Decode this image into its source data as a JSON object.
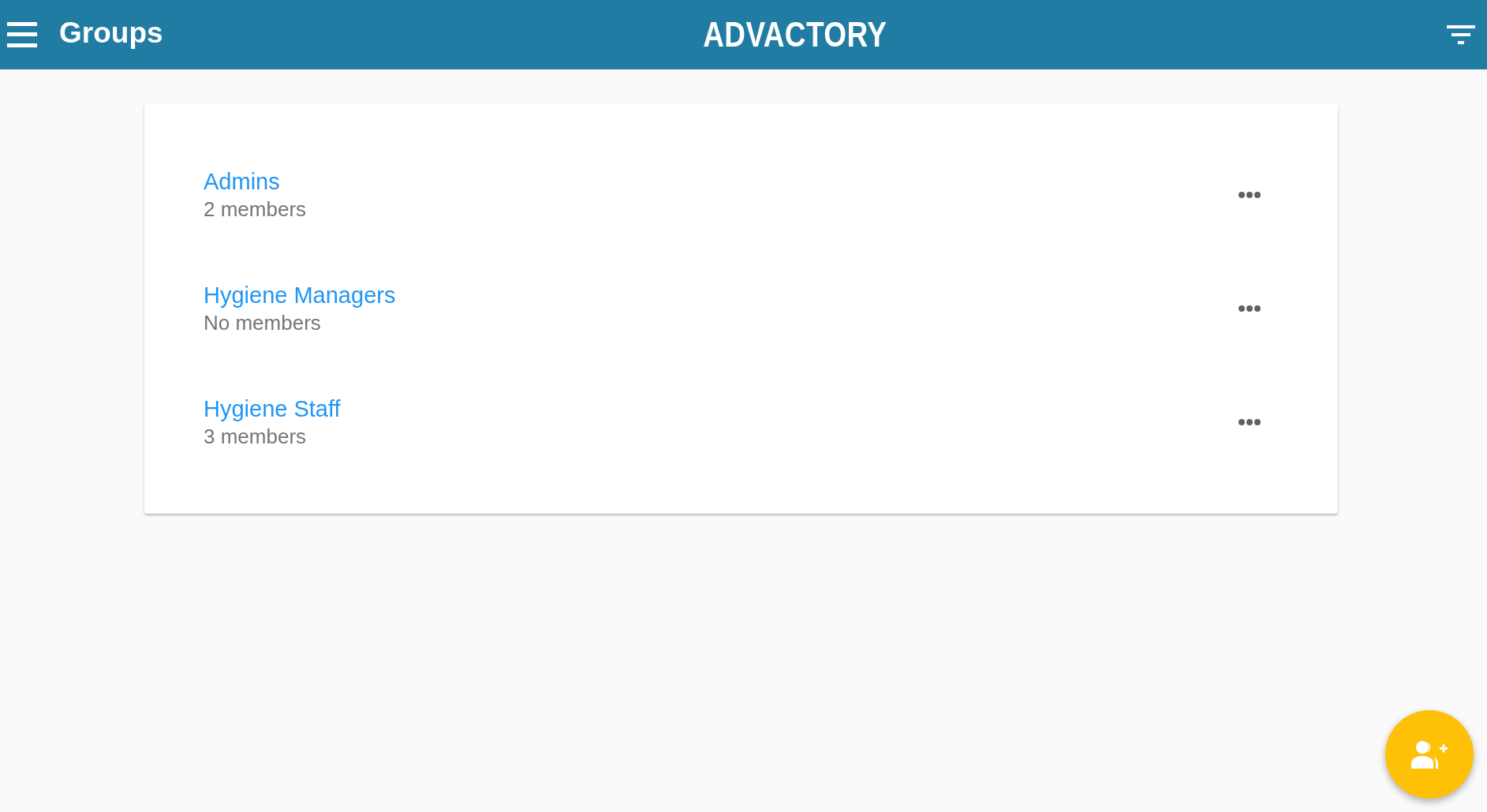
{
  "app_bar": {
    "title": "Groups",
    "logo": "ADVACTORY"
  },
  "groups": [
    {
      "name": "Admins",
      "members": "2 members"
    },
    {
      "name": "Hygiene Managers",
      "members": "No members"
    },
    {
      "name": "Hygiene Staff",
      "members": "3 members"
    }
  ]
}
